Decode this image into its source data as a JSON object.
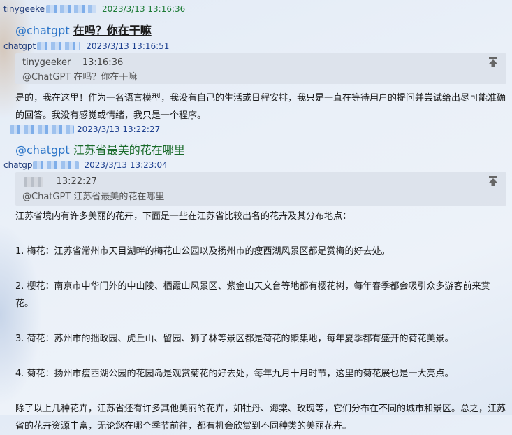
{
  "messages": [
    {
      "sender": "tinygeeke",
      "timestamp": "2023/3/13 13:16:36",
      "mention": "@chatgpt",
      "text": "在吗？你在干嘛"
    },
    {
      "sender": "chatgpt",
      "timestamp": "2023/3/13 13:16:51",
      "quote": {
        "author": "tinygeeker",
        "time": "13:16:36",
        "text": "@ChatGPT  在吗？你在干嘛"
      },
      "reply": [
        "是的，我在这里！作为一名语言模型，我没有自己的生活或日程安排，我只是一直在等待用户的提问并尝试给出尽可能准确",
        "的回答。我没有感觉或情绪，我只是一个程序。"
      ]
    },
    {
      "sender": "",
      "timestamp": "2023/3/13 13:22:27",
      "mention": "@chatgpt",
      "text": "江苏省最美的花在哪里"
    },
    {
      "sender": "chatgp",
      "timestamp": "2023/3/13 13:23:04",
      "quote": {
        "author": "",
        "time": "13:22:27",
        "text": "@ChatGPT  江苏省最美的花在哪里"
      },
      "reply": [
        "江苏省境内有许多美丽的花卉，下面是一些在江苏省比较出名的花卉及其分布地点：",
        "1. 梅花：江苏省常州市天目湖畔的梅花山公园以及扬州市的瘦西湖风景区都是赏梅的好去处。",
        "2. 樱花：南京市中华门外的中山陵、栖霞山风景区、紫金山天文台等地都有樱花树，每年春季都会吸引众多游客前来赏花。",
        "3. 荷花：苏州市的拙政园、虎丘山、留园、狮子林等景区都是荷花的聚集地，每年夏季都有盛开的荷花美景。",
        "4. 菊花：扬州市瘦西湖公园的花园岛是观赏菊花的好去处，每年九月十月时节，这里的菊花展也是一大亮点。",
        "除了以上几种花卉，江苏省还有许多其他美丽的花卉，如牡丹、海棠、玫瑰等，它们分布在不同的城市和景区。总之，江苏",
        "省的花卉资源丰富，无论您在哪个季节前往，都有机会欣赏到不同种类的美丽花卉。"
      ]
    }
  ],
  "icons": {
    "pin": "pin-to-top-icon"
  }
}
